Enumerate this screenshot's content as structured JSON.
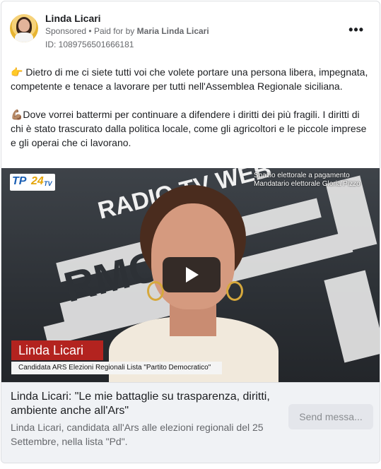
{
  "ad": {
    "page_name": "Linda Licari",
    "sponsored_label": "Sponsored",
    "separator": "•",
    "paid_for_prefix": "Paid for by",
    "paid_for_name": "Maria Linda Licari",
    "ad_id": "ID: 1089756501666181",
    "more_options_icon": "more-horizontal-icon",
    "more_options_label": "•••"
  },
  "body": {
    "paragraph_1": "👉 Dietro di me ci siete tutti voi che volete portare una persona libera, impegnata, competente e tenace a lavorare per tutti nell'Assemblea Regionale siciliana.",
    "paragraph_2": "💪🏽Dove vorrei battermi per continuare a difendere i diritti dei più fragili. I diritti di chi è stato trascurato dalla politica locale, come gli agricoltori e le piccole imprese e gli operai che ci lavorano.",
    "truncation": "..."
  },
  "video": {
    "channel_logo_a": "TP",
    "channel_logo_b": "24",
    "channel_logo_c": "TV",
    "notice_line_1": "Spazio elettorale a pagamento",
    "notice_line_2": "Mandatario elettorale Gloria Pizzo",
    "lower_third_name": "Linda Licari",
    "lower_third_subtitle": "Candidata ARS Elezioni Regionali  Lista \"Partito Democratico\"",
    "background_text_1": "RADIO TV WEB",
    "background_text_2": "RMC 101",
    "play_icon": "play-icon"
  },
  "link": {
    "headline": "Linda Licari: \"Le mie battaglie su trasparenza, diritti, ambiente anche all'Ars\"",
    "description": "Linda Licari, candidata all'Ars alle elezioni regionali del 25 Settembre, nella lista \"Pd\".",
    "cta_label": "Send messa..."
  },
  "colors": {
    "accent_red": "#b3231f",
    "text_secondary": "#65676b",
    "footer_bg": "#f0f2f5"
  }
}
